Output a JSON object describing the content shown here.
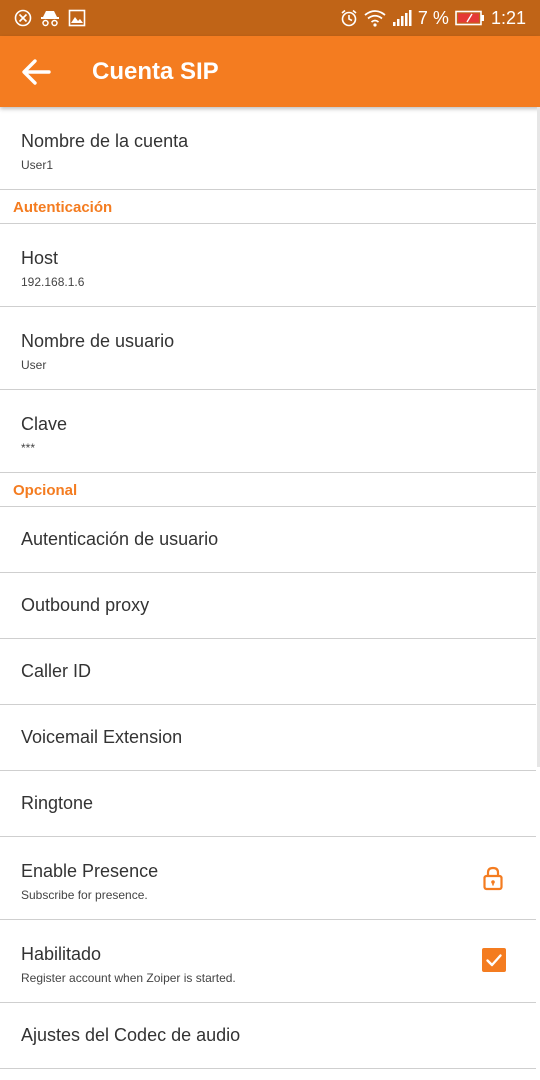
{
  "status_bar": {
    "battery_percent": "7 %",
    "time": "1:21",
    "left_icons": [
      "blocked-icon",
      "incognito-icon",
      "gallery-icon"
    ],
    "right_icons": [
      "alarm-icon",
      "wifi-icon",
      "signal-icon",
      "battery-icon"
    ]
  },
  "app_bar": {
    "title": "Cuenta SIP",
    "back_icon": "arrow-left-icon",
    "color": "#f47c20"
  },
  "items_top": [
    {
      "label": "Nombre de la cuenta",
      "value": "User1"
    }
  ],
  "section_auth": {
    "title": "Autenticación",
    "items": [
      {
        "label": "Host",
        "value": "192.168.1.6"
      },
      {
        "label": "Nombre de usuario",
        "value": "User"
      },
      {
        "label": "Clave",
        "value": "***"
      }
    ]
  },
  "section_optional": {
    "title": "Opcional",
    "items": [
      {
        "label": "Autenticación de usuario"
      },
      {
        "label": "Outbound proxy"
      },
      {
        "label": "Caller ID"
      },
      {
        "label": "Voicemail Extension"
      },
      {
        "label": "Ringtone"
      },
      {
        "label": "Enable Presence",
        "value": "Subscribe for presence.",
        "icon": "lock-icon"
      },
      {
        "label": "Habilitado",
        "value": "Register account when Zoiper is started.",
        "checked": true
      },
      {
        "label": "Ajustes del Codec de audio"
      }
    ]
  }
}
